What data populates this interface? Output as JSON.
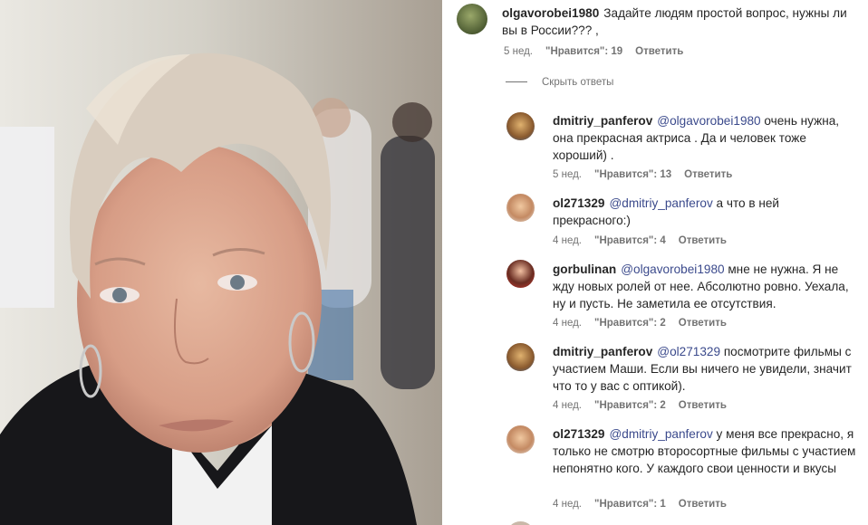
{
  "comments": {
    "main": {
      "user": "olgavorobei1980",
      "text": "Задайте людям простой вопрос, нужны ли вы в России??? ,",
      "time": "5 нед.",
      "likes": "\"Нравится\": 19",
      "reply": "Ответить"
    },
    "hide_replies": "Скрыть ответы",
    "replies": [
      {
        "user": "dmitriy_panferov",
        "mention": "@olgavorobei1980",
        "text": " очень нужна, она прекрасная актриса . Да и человек тоже хороший) .",
        "time": "5 нед.",
        "likes": "\"Нравится\": 13",
        "reply": "Ответить"
      },
      {
        "user": "ol271329",
        "mention": "@dmitriy_panferov",
        "text": " а что в ней прекрасного:)",
        "time": "4 нед.",
        "likes": "\"Нравится\": 4",
        "reply": "Ответить"
      },
      {
        "user": "gorbulinan",
        "mention": "@olgavorobei1980",
        "text": " мне не нужна. Я не жду новых ролей от нее. Абсолютно ровно. Уехала, ну и пусть. Не заметила ее отсутствия.",
        "time": "4 нед.",
        "likes": "\"Нравится\": 2",
        "reply": "Ответить"
      },
      {
        "user": "dmitriy_panferov",
        "mention": "@ol271329",
        "text": " посмотрите фильмы с участием Маши. Если вы ничего не увидели, значит что то у вас с оптикой).",
        "time": "4 нед.",
        "likes": "\"Нравится\": 2",
        "reply": "Ответить"
      },
      {
        "user": "ol271329",
        "mention": "@dmitriy_panferov",
        "text": " у меня все прекрасно, я только не смотрю второсортные фильмы с участием непонятно кого. У каждого свои ценности и вкусы",
        "time": "4 нед.",
        "likes": "\"Нравится\": 1",
        "reply": "Ответить"
      }
    ]
  },
  "colors": {
    "mention": "#3b4a8c",
    "meta": "#737373",
    "text": "#262626"
  }
}
